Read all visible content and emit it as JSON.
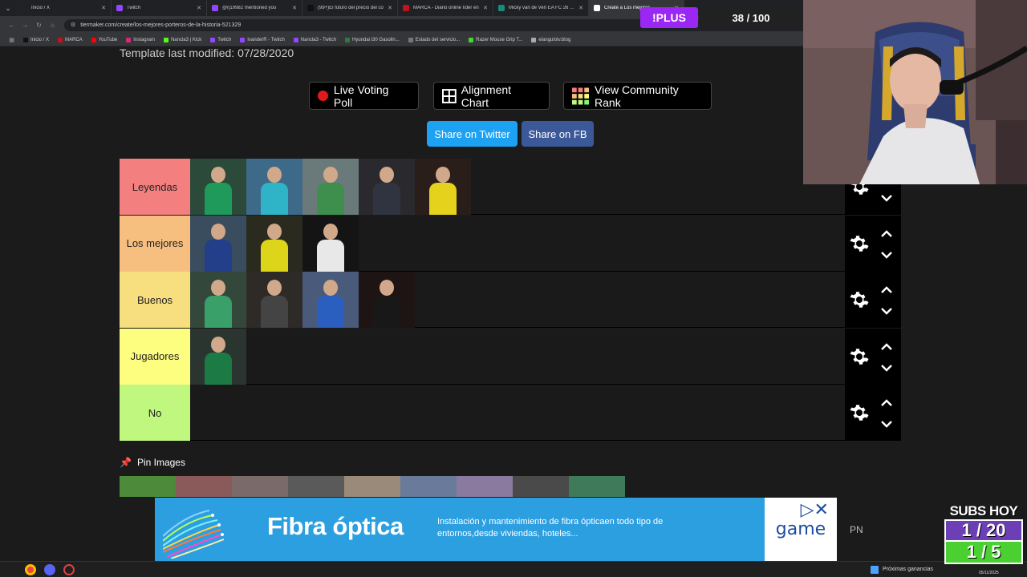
{
  "browser": {
    "tabs": [
      {
        "title": "Inicio / X",
        "color": "#222222",
        "active": false
      },
      {
        "title": "Twitch",
        "color": "#9146ff",
        "active": false
      },
      {
        "title": "@rj19982 mentioned you",
        "color": "#9146ff",
        "active": false
      },
      {
        "title": "(99+)El futuro del precio del co",
        "color": "#111111",
        "active": false
      },
      {
        "title": "MARCA - Diario online líder en",
        "color": "#c1121f",
        "active": false
      },
      {
        "title": "Micky van de Ven EA FC 26 - S",
        "color": "#1a8b7a",
        "active": false
      },
      {
        "title": "Create a Los mejores",
        "color": "#ffffff",
        "active": true
      }
    ],
    "url": "tiermaker.com/create/los-mejores-porteros-de-la-historia-521329",
    "bookmarks": [
      {
        "label": "Inicio / X",
        "color": "#111111"
      },
      {
        "label": "MARCA",
        "color": "#c1121f"
      },
      {
        "label": "YouTube",
        "color": "#ff0000"
      },
      {
        "label": "Instagram",
        "color": "#d62976"
      },
      {
        "label": "Nancla3 | Kick",
        "color": "#53fc18"
      },
      {
        "label": "Twitch",
        "color": "#9146ff"
      },
      {
        "label": "IvanderR - Twitch",
        "color": "#9146ff"
      },
      {
        "label": "Nancla3 - Twitch",
        "color": "#9146ff"
      },
      {
        "label": "Hyundai i30 Gasolin...",
        "color": "#2d7a3e"
      },
      {
        "label": "Estado del servicio...",
        "color": "#777777"
      },
      {
        "label": "Razer Mouse Grip T...",
        "color": "#44d62c"
      },
      {
        "label": "elangulotv.blog",
        "color": "#aaaaaa"
      }
    ]
  },
  "page": {
    "template_modified": "Template last modified: 07/28/2020",
    "buttons": {
      "live_poll": "Live Voting Poll",
      "alignment": "Alignment Chart",
      "community_rank": "View Community Rank",
      "share_twitter": "Share on Twitter",
      "share_fb": "Share on FB"
    },
    "tiers": [
      {
        "label": "Leyendas",
        "color": "#f47f7f",
        "items": [
          {
            "bg": "#2b4a3a",
            "kit": "#1f9a5a"
          },
          {
            "bg": "#3e6a8a",
            "kit": "#2fb3c6"
          },
          {
            "bg": "#6a7a7a",
            "kit": "#3e8f4e"
          },
          {
            "bg": "#2a2a2e",
            "kit": "#2f3440"
          },
          {
            "bg": "#2a1e1a",
            "kit": "#e4d21d"
          }
        ]
      },
      {
        "label": "Los mejores",
        "color": "#f7bf7f",
        "items": [
          {
            "bg": "#3a4d5e",
            "kit": "#233f8a"
          },
          {
            "bg": "#2a2a1e",
            "kit": "#ddd51a"
          },
          {
            "bg": "#141414",
            "kit": "#e8e8e8"
          }
        ]
      },
      {
        "label": "Buenos",
        "color": "#f7de7f",
        "items": [
          {
            "bg": "#33473a",
            "kit": "#39a06a"
          },
          {
            "bg": "#2e2a28",
            "kit": "#444444"
          },
          {
            "bg": "#4a5a7a",
            "kit": "#2a5fbf"
          },
          {
            "bg": "#1e1414",
            "kit": "#181818"
          }
        ]
      },
      {
        "label": "Jugadores",
        "color": "#fdfd7f",
        "items": [
          {
            "bg": "#2a3530",
            "kit": "#1c7a44"
          }
        ]
      },
      {
        "label": "No",
        "color": "#bff77f",
        "items": []
      }
    ],
    "pin_title": "Pin Images",
    "pin_colors": [
      "#4d8a3a",
      "#8a5a5a",
      "#7a6a6a",
      "#5a5a5a",
      "#9a8a7a",
      "#6a7a9a",
      "#8a7aa0",
      "#4a4a4a",
      "#3f7a5a"
    ]
  },
  "ad": {
    "title": "Fibra óptica",
    "text": "Instalación y mantenimiento de fibra ópticaen todo tipo de entornos,desde viviendas, hoteles...",
    "logo": "game",
    "pn": "PN"
  },
  "overlay": {
    "plus": "!PLUS",
    "counter": "38 / 100",
    "subs_title": "SUBS HOY",
    "subs_1": "1 / 20",
    "subs_2": "1 / 5"
  },
  "taskbar": {
    "earnings": "Próximas ganancias",
    "date": "05/11/2025"
  }
}
